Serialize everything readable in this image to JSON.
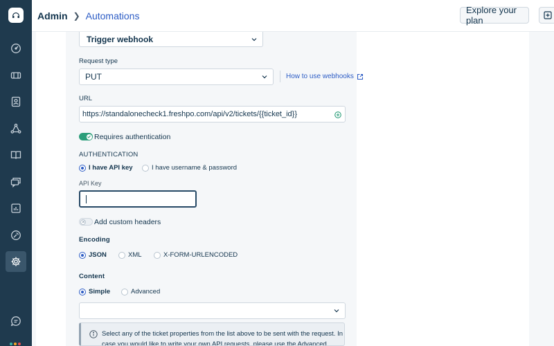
{
  "topbar": {
    "breadcrumb_root": "Admin",
    "breadcrumb_current": "Automations",
    "explore_plan": "Explore your plan"
  },
  "sidebar": {
    "items": [
      {
        "icon": "dashboard-icon"
      },
      {
        "icon": "tickets-icon"
      },
      {
        "icon": "contacts-icon"
      },
      {
        "icon": "groups-icon"
      },
      {
        "icon": "solutions-icon"
      },
      {
        "icon": "forums-icon"
      },
      {
        "icon": "reports-icon"
      },
      {
        "icon": "tools-icon"
      },
      {
        "icon": "admin-gear-icon",
        "active": true
      },
      {
        "icon": "chat-icon"
      }
    ]
  },
  "form": {
    "action_value": "Trigger webhook",
    "request_type_label": "Request type",
    "request_type_value": "PUT",
    "how_to_link": "How to use webhooks",
    "url_label": "URL",
    "url_value": "https://standalonecheck1.freshpo.com/api/v2/tickets/{{ticket_id}}",
    "requires_auth_label": "Requires authentication",
    "requires_auth_on": true,
    "authentication_heading": "AUTHENTICATION",
    "auth_option_api_key": "I have API key",
    "auth_option_userpass": "I have username & password",
    "api_key_label": "API Key",
    "api_key_value": "",
    "custom_headers_label": "Add custom headers",
    "custom_headers_on": false,
    "encoding_heading": "Encoding",
    "encoding_json": "JSON",
    "encoding_xml": "XML",
    "encoding_form": "X-FORM-URLENCODED",
    "content_heading": "Content",
    "content_simple": "Simple",
    "content_advanced": "Advanced",
    "content_select_value": "",
    "info_text": "Select any of the ticket properties from the list above to be sent with the request. In case you would like to write your own API requests, please use the Advanced"
  },
  "colors": {
    "sidebar_bg": "#1f3a4e",
    "accent": "#2c5cc5",
    "toggle_on": "#2c9e7a",
    "focus_border": "#264966"
  }
}
